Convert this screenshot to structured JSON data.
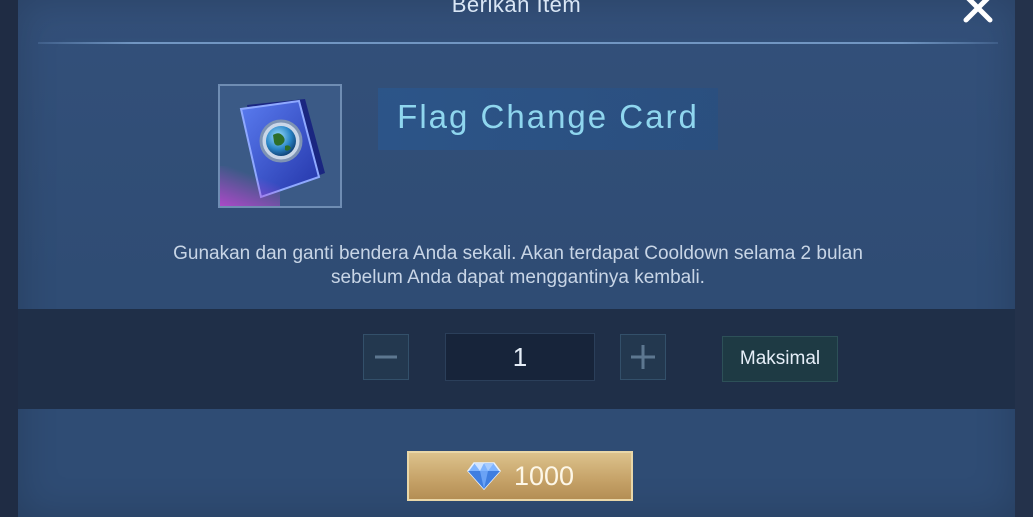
{
  "dialog": {
    "title": "Berikan Item",
    "item": {
      "name": "Flag Change Card",
      "icon": "flag-change-card-icon",
      "description_line1": "Gunakan dan ganti bendera Anda sekali. Akan terdapat Cooldown selama 2 bulan",
      "description_line2": "sebelum Anda dapat menggantinya kembali."
    },
    "quantity": {
      "value": "1",
      "max_label": "Maksimal"
    },
    "price": {
      "amount": "1000",
      "currency_icon": "diamond-icon"
    }
  },
  "colors": {
    "accent_text": "#8fd6ee",
    "gold_button": "#c7a46a"
  }
}
